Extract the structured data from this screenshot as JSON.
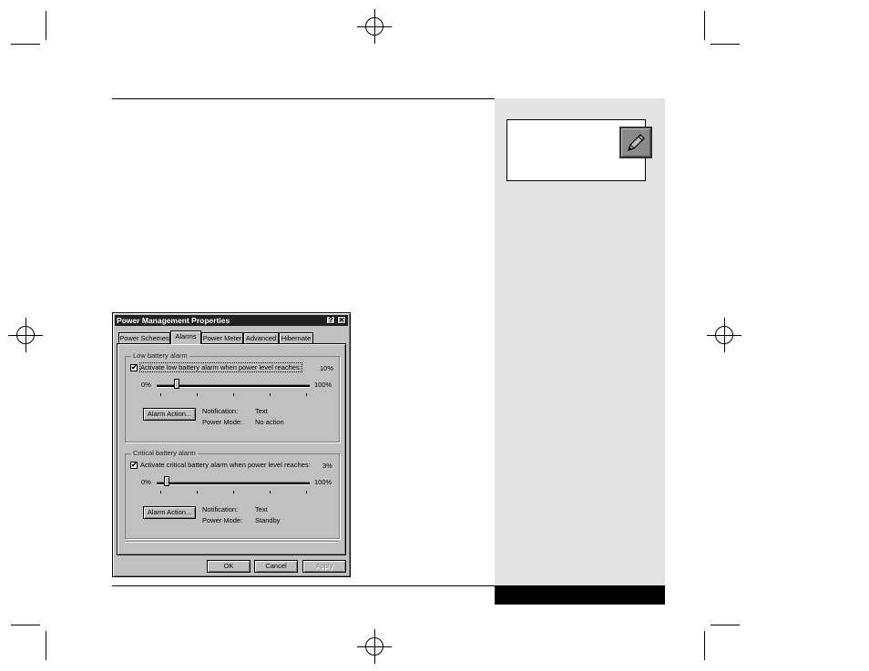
{
  "sidebar": {
    "note_icon": "pencil-icon"
  },
  "dialog": {
    "title": "Power Management Properties",
    "help_label": "?",
    "close_label": "✕",
    "tabs": [
      {
        "label": "Power Schemes"
      },
      {
        "label": "Alarms"
      },
      {
        "label": "Power Meter"
      },
      {
        "label": "Advanced"
      },
      {
        "label": "Hibernate"
      }
    ],
    "active_tab": "Alarms",
    "low_battery": {
      "group_title": "Low battery alarm",
      "checkbox_label": "Activate low battery alarm when power level reaches:",
      "checked": true,
      "value_label": "10%",
      "level_percent": 10,
      "min_label": "0%",
      "max_label": "100%",
      "action_button": "Alarm Action...",
      "notification_label": "Notification:",
      "notification_value": "Text",
      "power_mode_label": "Power Mode:",
      "power_mode_value": "No action"
    },
    "critical_battery": {
      "group_title": "Critical battery alarm",
      "checkbox_label": "Activate critical battery alarm when power level reaches:",
      "checked": true,
      "value_label": "3%",
      "level_percent": 3,
      "min_label": "0%",
      "max_label": "100%",
      "action_button": "Alarm Action...",
      "notification_label": "Notification:",
      "notification_value": "Text",
      "power_mode_label": "Power Mode:",
      "power_mode_value": "Standby"
    },
    "buttons": {
      "ok": "OK",
      "cancel": "Cancel",
      "apply": "Apply"
    },
    "check_glyph": "✔"
  }
}
